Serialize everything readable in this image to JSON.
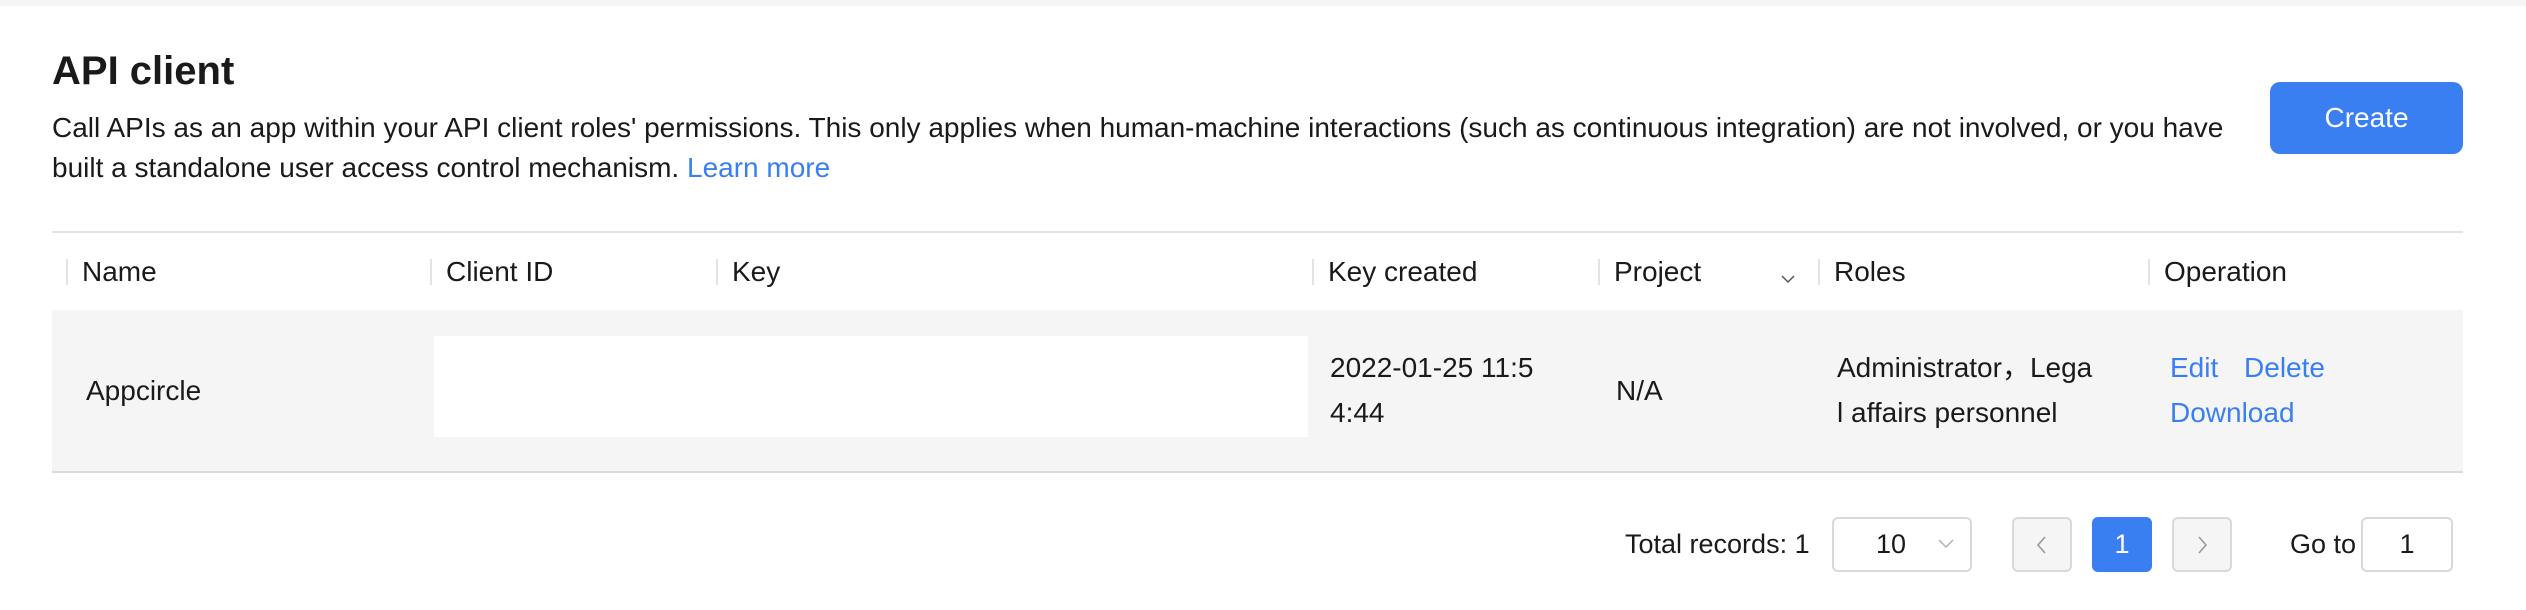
{
  "header": {
    "title": "API client",
    "description": "Call APIs as an app within your API client roles' permissions. This only applies when human-machine interactions (such as continuous integration) are not involved, or you have built a standalone user access control mechanism.",
    "learn_more": "Learn more",
    "create_label": "Create"
  },
  "colors": {
    "accent": "#3a7ff2",
    "row_bg": "#f5f5f5",
    "border": "#e3e3e3"
  },
  "table": {
    "columns": [
      {
        "label": "Name"
      },
      {
        "label": "Client ID"
      },
      {
        "label": "Key"
      },
      {
        "label": "Key created"
      },
      {
        "label": "Project",
        "filter_icon": "chevron-down-icon"
      },
      {
        "label": "Roles"
      },
      {
        "label": "Operation"
      }
    ],
    "rows": [
      {
        "name": "Appcircle",
        "client_id": "",
        "key": "",
        "key_created_line1": "2022-01-25 11:5",
        "key_created_line2": "4:44",
        "project": "N/A",
        "roles_line1": "Administrator，Lega",
        "roles_line2": "l affairs personnel",
        "operations": {
          "edit": "Edit",
          "delete": "Delete",
          "download": "Download"
        }
      }
    ]
  },
  "pagination": {
    "total_label": "Total records: 1",
    "page_size": "10",
    "current_page": "1",
    "goto_label": "Go to",
    "goto_value": "1"
  }
}
